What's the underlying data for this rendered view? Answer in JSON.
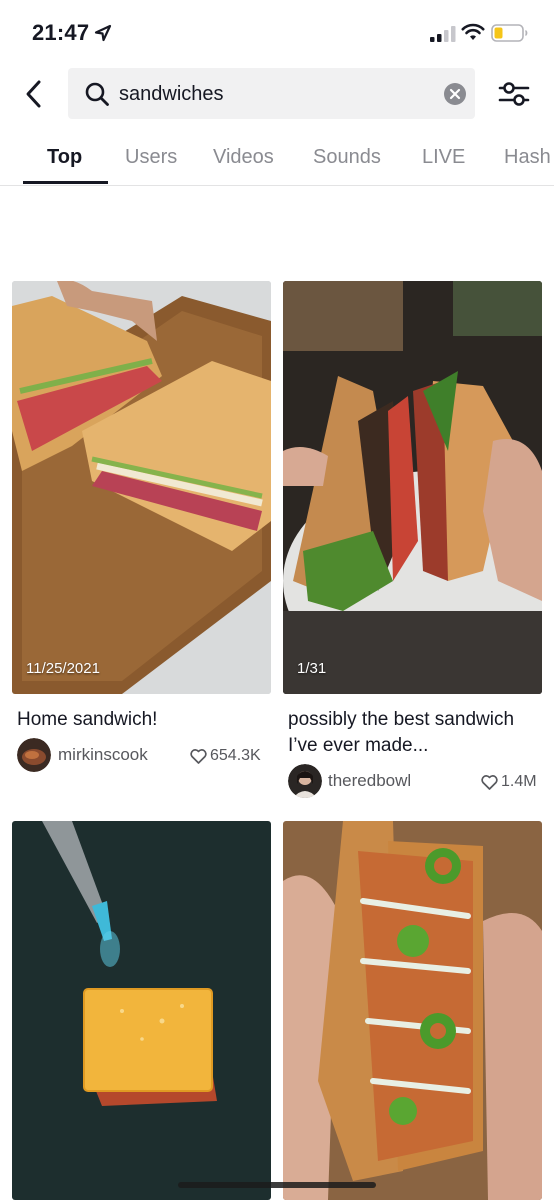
{
  "status": {
    "time": "21:47"
  },
  "search": {
    "query": "sandwiches"
  },
  "tabs": [
    "Top",
    "Users",
    "Videos",
    "Sounds",
    "LIVE",
    "Hash"
  ],
  "results": [
    {
      "date": "11/25/2021",
      "caption": "Home sandwich!",
      "username": "mirkinscook",
      "likes": "654.3K"
    },
    {
      "date": "1/31",
      "caption": "possibly the best sandwich I’ve ever made...",
      "username": "theredbowl",
      "likes": "1.4M"
    },
    {
      "date": "",
      "caption": "",
      "username": "",
      "likes": ""
    },
    {
      "date": "",
      "caption": "",
      "username": "",
      "likes": ""
    }
  ],
  "icons": {
    "back": "chevron-left-icon",
    "search": "search-icon",
    "clear": "clear-icon",
    "filter": "filter-sliders-icon",
    "like": "heart-outline-icon"
  },
  "colors": {
    "text": "#161823",
    "muted": "#8a8b91",
    "battery": "#f5c518"
  }
}
